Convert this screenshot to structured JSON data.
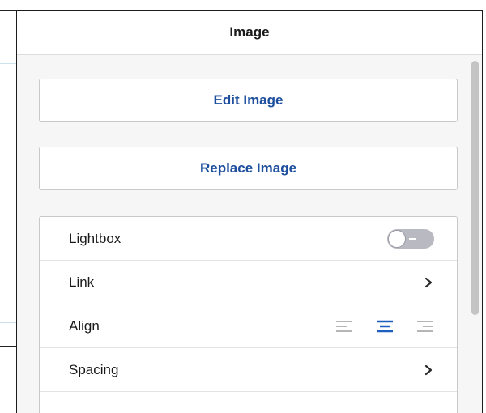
{
  "panel": {
    "title": "Image"
  },
  "actions": {
    "edit_label": "Edit Image",
    "replace_label": "Replace Image"
  },
  "settings": {
    "lightbox": {
      "label": "Lightbox",
      "enabled": false
    },
    "link": {
      "label": "Link"
    },
    "align": {
      "label": "Align",
      "options": [
        "left",
        "center",
        "right"
      ],
      "selected": "center"
    },
    "spacing": {
      "label": "Spacing"
    }
  },
  "colors": {
    "accent": "#1d4f9e",
    "align_inactive": "#b5b5b5",
    "align_active": "#1d5fc0",
    "toggle_off": "#b9b9c2"
  },
  "icons": {
    "link_chevron": "chevron-right-icon",
    "spacing_chevron": "chevron-right-icon",
    "align_left": "align-left-icon",
    "align_center": "align-center-icon",
    "align_right": "align-right-icon"
  }
}
